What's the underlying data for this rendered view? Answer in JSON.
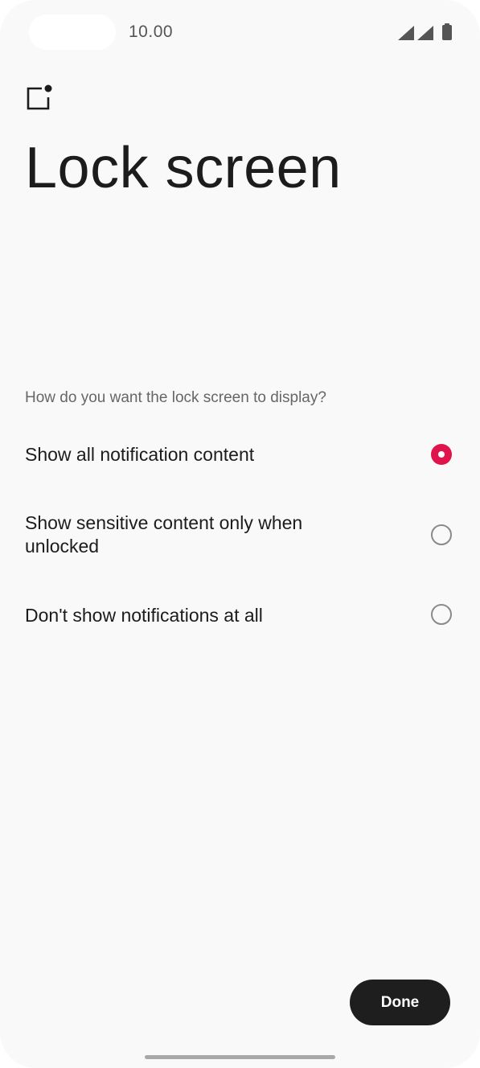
{
  "status_bar": {
    "time": "10.00",
    "icons": [
      "signal-icon",
      "signal-icon",
      "battery-icon"
    ]
  },
  "header": {
    "icon": "lock-screen-notification-icon",
    "title": "Lock screen"
  },
  "prompt": "How do you want the lock screen to display?",
  "options": [
    {
      "label": "Show all notification content",
      "selected": true
    },
    {
      "label": "Show sensitive content only when unlocked",
      "selected": false
    },
    {
      "label": "Don't show notifications at all",
      "selected": false
    }
  ],
  "footer": {
    "done_label": "Done"
  },
  "colors": {
    "accent": "#e0134a",
    "background": "#f9f9f9",
    "button": "#1e1e1e"
  }
}
